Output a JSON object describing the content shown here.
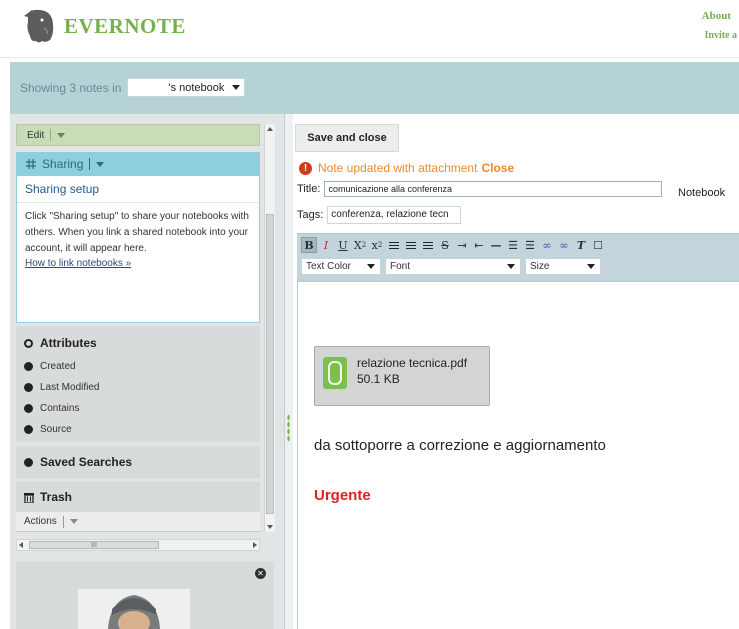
{
  "app": {
    "logo_text": "EVERNOTE",
    "brand_color": "#74b04e",
    "top_links": {
      "about": "About",
      "invite": "Invite a"
    }
  },
  "filter_bar": {
    "showing_label": "Showing 3 notes in",
    "notebook_value": "'s notebook"
  },
  "sidebar": {
    "edit_label": "Edit",
    "sharing": {
      "header": "Sharing",
      "setup": "Sharing setup",
      "description": "Click \"Sharing setup\" to share your notebooks with others. When you link a shared notebook into your account, it will appear here.",
      "link": "How to link notebooks »"
    },
    "attributes": {
      "title": "Attributes",
      "items": [
        {
          "label": "Created"
        },
        {
          "label": "Last Modified"
        },
        {
          "label": "Contains"
        },
        {
          "label": "Source"
        }
      ]
    },
    "saved_searches": "Saved Searches",
    "trash": "Trash",
    "actions": "Actions",
    "hscroll_mark": "III"
  },
  "editor": {
    "save_button": "Save and close",
    "notice": {
      "text": "Note updated with attachment",
      "close": "Close",
      "color": "#ef8a2f"
    },
    "title_label": "Title:",
    "title_value": "comunicazione alla conferenza",
    "notebook_label": "Notebook",
    "tags_label": "Tags:",
    "tags_value": "conferenza, relazione tecn",
    "toolbar": {
      "text_color": "Text Color",
      "font": "Font",
      "size": "Size"
    },
    "attachment": {
      "name": "relazione tecnica.pdf",
      "size": "50.1 KB"
    },
    "body_text": "da sottoporre a correzione e aggiornamento",
    "urgent_text": "Urgente",
    "urgent_color": "#dd2222"
  }
}
